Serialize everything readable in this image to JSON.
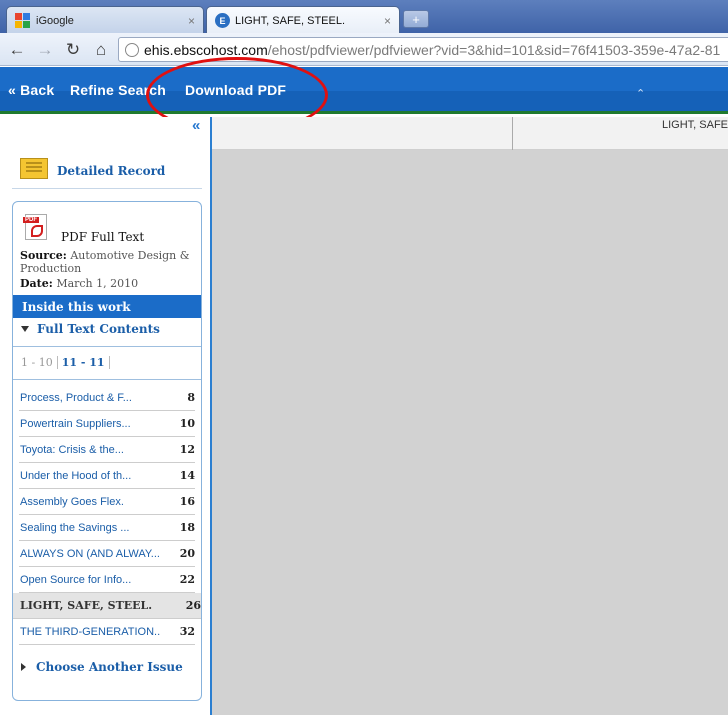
{
  "browser": {
    "tabs": [
      {
        "title": "iGoogle",
        "close": "×"
      },
      {
        "title": "LIGHT, SAFE, STEEL.",
        "close": "×"
      }
    ],
    "new_tab_icon": "plus-icon",
    "url_host": "ehis.ebscohost.com",
    "url_path": "/ehost/pdfviewer/pdfviewer?vid=3&hid=101&sid=76f41503-359e-47a2-81"
  },
  "ebsco_nav": {
    "back": "« Back",
    "refine": "Refine Search",
    "download": "Download PDF",
    "collapse_icon": "double-chevron-up-icon"
  },
  "sidebar": {
    "collapse": "«",
    "detailed_record": "Detailed Record",
    "pdf_label": "PDF Full Text",
    "source_label": "Source:",
    "source_value": "Automotive Design & Production",
    "date_label": "Date:",
    "date_value": "March 1, 2010",
    "inside_header": "Inside this work",
    "full_text_contents": "Full Text Contents",
    "pager": [
      "1 - 10",
      "11 - 11"
    ],
    "toc": [
      {
        "title": "Process, Product & F...",
        "page": "8"
      },
      {
        "title": "Powertrain Suppliers...",
        "page": "10"
      },
      {
        "title": "Toyota: Crisis & the...",
        "page": "12"
      },
      {
        "title": "Under the Hood of th...",
        "page": "14"
      },
      {
        "title": "Assembly Goes Flex.",
        "page": "16"
      },
      {
        "title": "Sealing the Savings ...",
        "page": "18"
      },
      {
        "title": "ALWAYS ON (AND ALWAY...",
        "page": "20"
      },
      {
        "title": "Open Source for Info...",
        "page": "22"
      },
      {
        "title": "LIGHT, SAFE, STEEL.",
        "page": "26"
      },
      {
        "title": "THE THIRD-GENERATION...",
        "page": "32"
      }
    ],
    "choose_issue": "Choose Another Issue"
  },
  "viewer": {
    "doc_title": "LIGHT, SAFE,"
  },
  "colors": {
    "ebsco_blue": "#1b6cc8",
    "link_blue": "#1b5ea8",
    "annotation_red": "#e01010"
  }
}
